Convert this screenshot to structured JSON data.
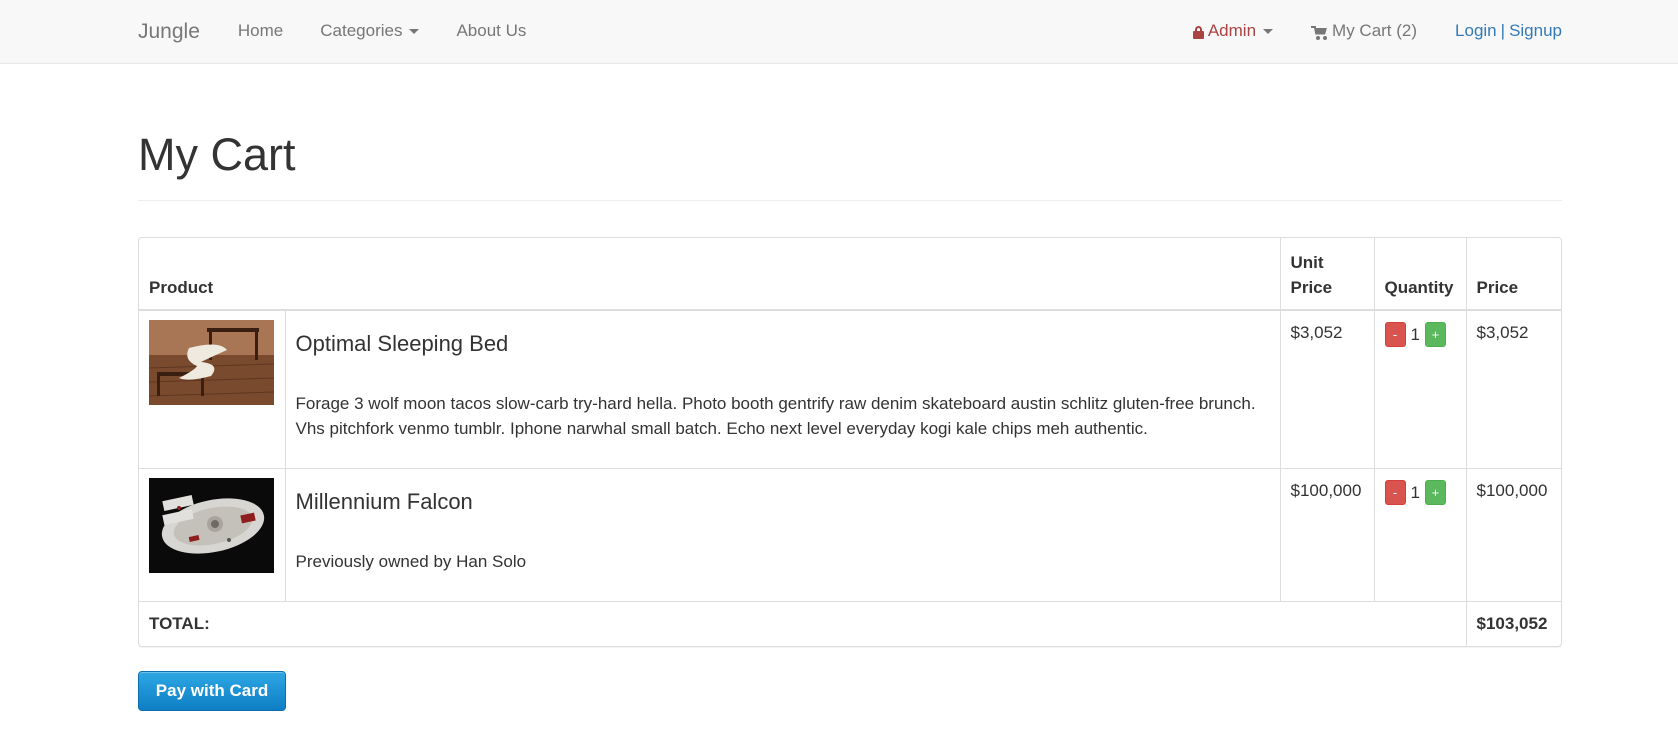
{
  "navbar": {
    "brand": "Jungle",
    "links": [
      {
        "label": "Home"
      },
      {
        "label": "Categories"
      },
      {
        "label": "About Us"
      }
    ],
    "admin_label": "Admin",
    "cart_label": "My Cart (2)",
    "login_label": "Login",
    "separator": "|",
    "signup_label": "Signup",
    "admin_color": "#a94442",
    "link_color": "#337ab7"
  },
  "page": {
    "title": "My Cart"
  },
  "table": {
    "headers": {
      "product": "Product",
      "unit_price": "Unit Price",
      "quantity": "Quantity",
      "price": "Price"
    },
    "rows": [
      {
        "image": "bed-photo",
        "name": "Optimal Sleeping Bed",
        "description": "Forage 3 wolf moon tacos slow-carb try-hard hella. Photo booth gentrify raw denim skateboard austin schlitz gluten-free brunch. Vhs pitchfork venmo tumblr. Iphone narwhal small batch. Echo next level everyday kogi kale chips meh authentic.",
        "unit_price": "$3,052",
        "quantity": "1",
        "price": "$3,052",
        "minus_label": "-",
        "plus_label": "+"
      },
      {
        "image": "spaceship-photo",
        "name": "Millennium Falcon",
        "description": "Previously owned by Han Solo",
        "unit_price": "$100,000",
        "quantity": "1",
        "price": "$100,000",
        "minus_label": "-",
        "plus_label": "+"
      }
    ],
    "total_label": "TOTAL:",
    "total_value": "$103,052"
  },
  "pay_button": {
    "label": "Pay with Card",
    "color": "#1a8fd6"
  }
}
